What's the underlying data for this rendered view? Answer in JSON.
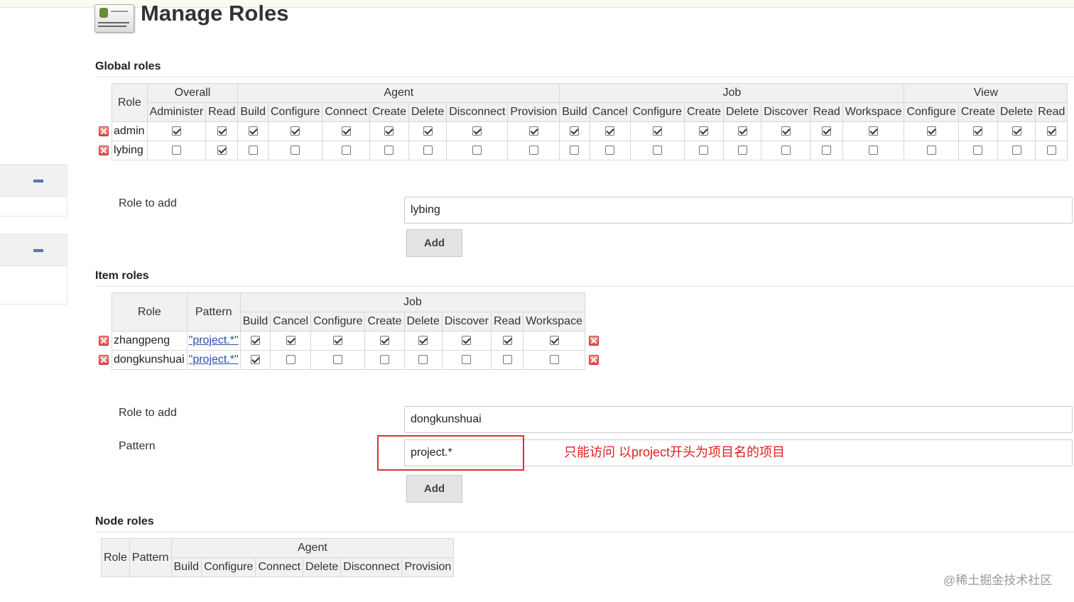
{
  "page_title": "Manage Roles",
  "global_roles": {
    "heading": "Global roles",
    "role_header": "Role",
    "groups": [
      {
        "name": "Overall",
        "perms": [
          "Administer",
          "Read"
        ]
      },
      {
        "name": "Agent",
        "perms": [
          "Build",
          "Configure",
          "Connect",
          "Create",
          "Delete",
          "Disconnect",
          "Provision"
        ]
      },
      {
        "name": "Job",
        "perms": [
          "Build",
          "Cancel",
          "Configure",
          "Create",
          "Delete",
          "Discover",
          "Read",
          "Workspace"
        ]
      },
      {
        "name": "View",
        "perms": [
          "Configure",
          "Create",
          "Delete",
          "Read"
        ]
      }
    ],
    "rows": [
      {
        "name": "admin",
        "checks": [
          true,
          true,
          true,
          true,
          true,
          true,
          true,
          true,
          true,
          true,
          true,
          true,
          true,
          true,
          true,
          true,
          true,
          true,
          true,
          true,
          true
        ]
      },
      {
        "name": "lybing",
        "checks": [
          false,
          true,
          false,
          false,
          false,
          false,
          false,
          false,
          false,
          false,
          false,
          false,
          false,
          false,
          false,
          false,
          false,
          false,
          false,
          false,
          false
        ]
      }
    ],
    "role_to_add_label": "Role to add",
    "role_to_add_value": "lybing",
    "add_label": "Add"
  },
  "item_roles": {
    "heading": "Item roles",
    "role_header": "Role",
    "pattern_header": "Pattern",
    "groups": [
      {
        "name": "Job",
        "perms": [
          "Build",
          "Cancel",
          "Configure",
          "Create",
          "Delete",
          "Discover",
          "Read",
          "Workspace"
        ]
      }
    ],
    "rows": [
      {
        "name": "zhangpeng",
        "pattern": "\"project.*\"",
        "checks": [
          true,
          true,
          true,
          true,
          true,
          true,
          true,
          true
        ]
      },
      {
        "name": "dongkunshuai",
        "pattern": "\"project.*\"",
        "checks": [
          true,
          false,
          false,
          false,
          false,
          false,
          false,
          false
        ]
      }
    ],
    "role_to_add_label": "Role to add",
    "role_to_add_value": "dongkunshuai",
    "pattern_label": "Pattern",
    "pattern_value": "project.*",
    "add_label": "Add",
    "annotation": "只能访问 以project开头为项目名的项目"
  },
  "node_roles": {
    "heading": "Node roles",
    "role_header": "Role",
    "pattern_header": "Pattern",
    "groups": [
      {
        "name": "Agent",
        "perms": [
          "Build",
          "Configure",
          "Connect",
          "Delete",
          "Disconnect",
          "Provision"
        ]
      }
    ]
  },
  "watermark": "@稀土掘金技术社区",
  "colors": {
    "annotation": "#e02020",
    "link": "#2a4fa8"
  }
}
